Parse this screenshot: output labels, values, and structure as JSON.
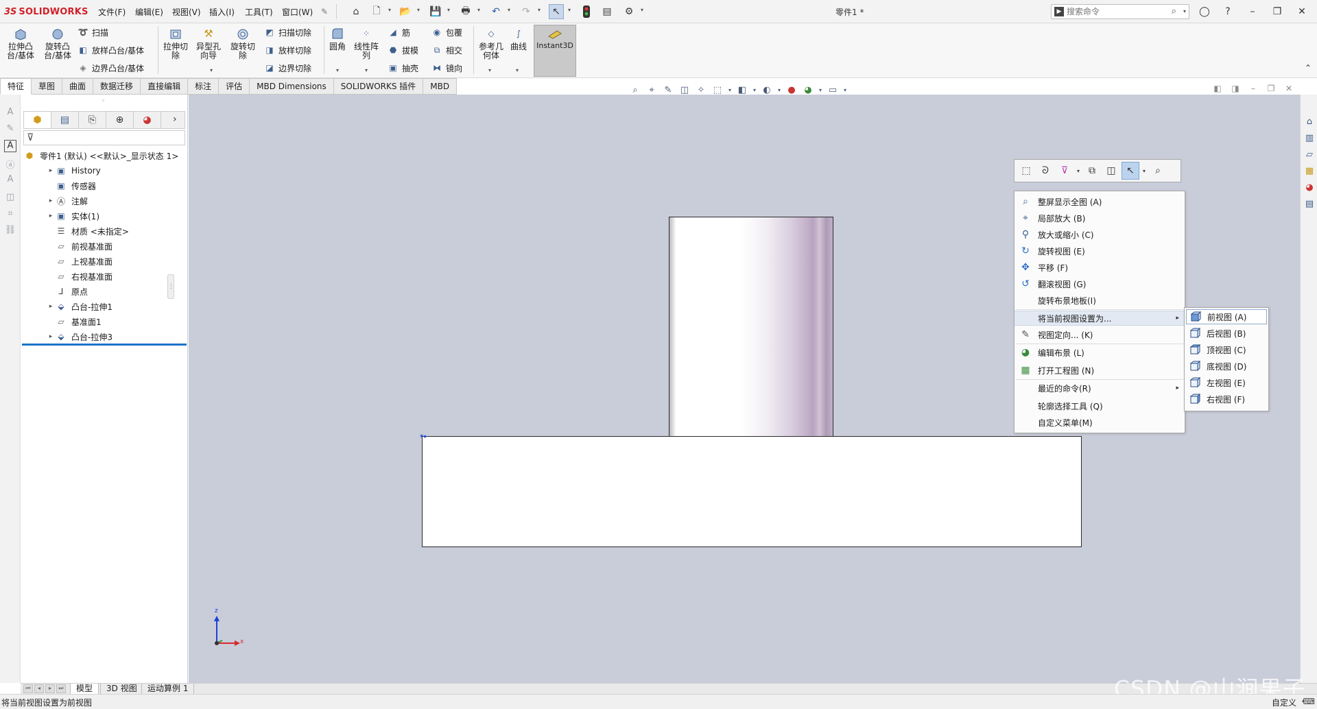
{
  "titlebar": {
    "brand_prefix": "3S",
    "brand": "SOLIDWORKS",
    "menus": [
      "文件(F)",
      "编辑(E)",
      "视图(V)",
      "插入(I)",
      "工具(T)",
      "窗口(W)"
    ],
    "document_title": "零件1 *",
    "search_placeholder": "搜索命令"
  },
  "ribbon": {
    "extrude_boss": "拉伸凸\n台/基体",
    "revolve_boss": "旋转凸\n台/基体",
    "sweep": "扫描",
    "loft_boss": "放样凸台/基体",
    "boundary_boss": "边界凸台/基体",
    "extrude_cut": "拉伸切\n除",
    "hole_wizard": "异型孔\n向导",
    "revolve_cut": "旋转切\n除",
    "swept_cut": "扫描切除",
    "lofted_cut": "放样切除",
    "boundary_cut": "边界切除",
    "fillet": "圆角",
    "linear_pattern": "线性阵\n列",
    "rib": "筋",
    "draft": "拔模",
    "shell": "抽壳",
    "wrap": "包覆",
    "intersect": "相交",
    "mirror": "镜向",
    "ref_geometry": "参考几\n何体",
    "curves": "曲线",
    "instant3d": "Instant3D"
  },
  "cm_tabs": [
    "特征",
    "草图",
    "曲面",
    "数据迁移",
    "直接编辑",
    "标注",
    "评估",
    "MBD Dimensions",
    "SOLIDWORKS 插件",
    "MBD"
  ],
  "feature_tree": {
    "root": "零件1 (默认) <<默认>_显示状态 1>",
    "items": [
      {
        "label": "History",
        "arrow": true
      },
      {
        "label": "传感器",
        "arrow": false
      },
      {
        "label": "注解",
        "arrow": true
      },
      {
        "label": "实体(1)",
        "arrow": true
      },
      {
        "label": "材质 <未指定>",
        "arrow": false
      },
      {
        "label": "前视基准面",
        "arrow": false
      },
      {
        "label": "上视基准面",
        "arrow": false
      },
      {
        "label": "右视基准面",
        "arrow": false
      },
      {
        "label": "原点",
        "arrow": false
      },
      {
        "label": "凸台-拉伸1",
        "arrow": true
      },
      {
        "label": "基准面1",
        "arrow": false
      },
      {
        "label": "凸台-拉伸3",
        "arrow": true
      }
    ]
  },
  "context_menu": {
    "items": [
      {
        "label": "整屏显示全图 (A)",
        "icon": "zoom-fit-icon"
      },
      {
        "label": "局部放大 (B)",
        "icon": "zoom-area-icon"
      },
      {
        "label": "放大或缩小 (C)",
        "icon": "zoom-in-out-icon"
      },
      {
        "label": "旋转视图 (E)",
        "icon": "rotate-view-icon"
      },
      {
        "label": "平移 (F)",
        "icon": "pan-icon"
      },
      {
        "label": "翻滚视图 (G)",
        "icon": "roll-view-icon"
      },
      {
        "label": "旋转布景地板(I)",
        "icon": ""
      },
      {
        "label": "将当前视图设置为...",
        "icon": ""
      },
      {
        "label": "视图定向... (K)",
        "icon": "view-orientation-icon"
      },
      {
        "label": "编辑布景 (L)",
        "icon": "edit-scene-icon"
      },
      {
        "label": "打开工程图 (N)",
        "icon": "open-drawing-icon"
      },
      {
        "label": "最近的命令(R)",
        "icon": ""
      },
      {
        "label": "轮廓选择工具 (Q)",
        "icon": ""
      },
      {
        "label": "自定义菜单(M)",
        "icon": ""
      }
    ]
  },
  "submenu": {
    "items": [
      "前视图 (A)",
      "后视图 (B)",
      "顶视图 (C)",
      "底视图 (D)",
      "左视图 (E)",
      "右视图 (F)"
    ]
  },
  "triad": {
    "z": "z",
    "x": "x"
  },
  "bottom_tabs": [
    "模型",
    "3D 视图",
    "运动算例 1"
  ],
  "status": {
    "message": "将当前视图设置为前视图",
    "right": "自定义"
  },
  "watermark": "CSDN @山涧果子",
  "colors": {
    "brand_red": "#d21f28",
    "graphics_bg": "#c9ccd9",
    "highlight": "#e2e9f3",
    "rollback": "#1a73c8"
  }
}
